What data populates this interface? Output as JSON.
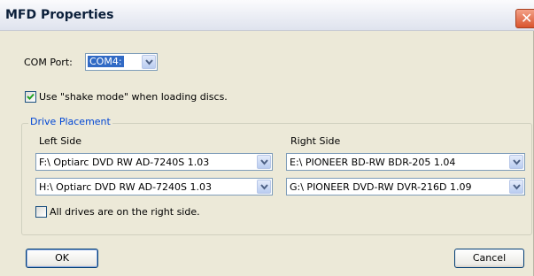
{
  "window": {
    "title": "MFD Properties"
  },
  "com_port": {
    "label": "COM Port:",
    "value": "COM4:"
  },
  "shake_mode": {
    "label": "Use \"shake mode\" when loading discs.",
    "checked": true
  },
  "drive_placement": {
    "title": "Drive Placement",
    "left_label": "Left Side",
    "right_label": "Right Side",
    "left": [
      "F:\\ Optiarc  DVD RW AD-7240S  1.03",
      "H:\\ Optiarc  DVD RW AD-7240S  1.03"
    ],
    "right": [
      "E:\\ PIONEER  BD-RW   BDR-205  1.04",
      "G:\\ PIONEER  DVD-RW  DVR-216D 1.09"
    ],
    "all_right": {
      "label": "All drives are on the right side.",
      "checked": false
    }
  },
  "buttons": {
    "ok": "OK",
    "cancel": "Cancel"
  },
  "icons": {
    "close": "close-icon",
    "dropdown": "chevron-down-icon",
    "check": "checkmark-icon"
  }
}
